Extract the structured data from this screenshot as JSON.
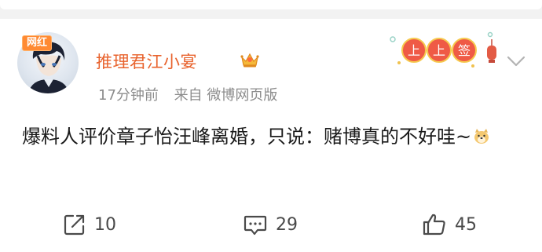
{
  "post": {
    "badge": "网红",
    "username": "推理君江小宴",
    "time": "17分钟前",
    "source": "来自 微博网页版",
    "text": "爆料人评价章子怡汪峰离婚，只说：赌博真的不好哇~",
    "festival_text": "上上签"
  },
  "actions": {
    "repost_count": "10",
    "comment_count": "29",
    "like_count": "45"
  },
  "icons": {
    "vip": "crown-vip-icon",
    "dropdown": "chevron-down-icon",
    "repost": "repost-icon",
    "comment": "comment-icon",
    "like": "thumbs-up-icon",
    "emoji": "doge-emoji-icon"
  },
  "colors": {
    "username": "#e8622c",
    "meta": "#8c8c8c",
    "text": "#1a1a1a",
    "badge": "#ff8a33"
  }
}
